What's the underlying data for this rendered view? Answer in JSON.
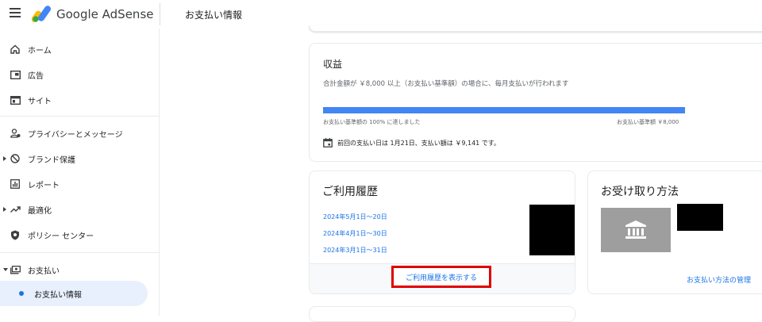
{
  "app": {
    "brand": "Google AdSense",
    "page_title": "お支払い情報"
  },
  "sidebar": {
    "items": [
      {
        "label": "ホーム",
        "icon": "home-icon"
      },
      {
        "label": "広告",
        "icon": "ads-icon"
      },
      {
        "label": "サイト",
        "icon": "sites-icon"
      },
      {
        "label": "プライバシーとメッセージ",
        "icon": "privacy-icon"
      },
      {
        "label": "ブランド保護",
        "icon": "block-icon"
      },
      {
        "label": "レポート",
        "icon": "report-icon"
      },
      {
        "label": "最適化",
        "icon": "trending-icon"
      },
      {
        "label": "ポリシー センター",
        "icon": "shield-icon"
      },
      {
        "label": "お支払い",
        "icon": "payments-icon"
      },
      {
        "label": "お支払い情報",
        "icon": "dot-icon"
      }
    ]
  },
  "earnings": {
    "title": "収益",
    "description": "合計金額が ￥8,000 以上（お支払い基準額）の場合に、毎月支払いが行われます",
    "progress_fraction": 1.0,
    "progress_left_label": "お支払い基準額の 100% に達しました",
    "progress_right_label": "お支払い基準額 ￥8,000",
    "next_payment": "前回の支払い日は 1月21日、支払い額は ￥9,141 です。"
  },
  "history": {
    "title": "ご利用履歴",
    "periods": [
      "2024年5月1日〜20日",
      "2024年4月1日〜30日",
      "2024年3月1日〜31日"
    ],
    "show_button": "ご利用履歴を表示する"
  },
  "payment_method": {
    "title": "お受け取り方法",
    "manage_link": "お支払い方法の管理"
  },
  "colors": {
    "accent": "#1a73e8",
    "progress": "#4285f4",
    "highlight_border": "#e00000",
    "bank_tile": "#9e9e9e"
  }
}
